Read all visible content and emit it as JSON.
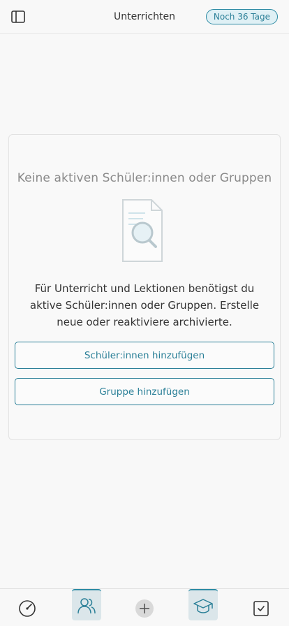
{
  "header": {
    "title": "Unterrichten",
    "trial_badge": "Noch 36 Tage",
    "sidebar_toggle_icon": "sidebar-panel-icon"
  },
  "empty_state": {
    "title": "Keine aktiven Schüler:innen oder Gruppen",
    "illustration": "document-search-icon",
    "description": "Für Unterricht und Lektionen benötigst du aktive Schüler:innen oder Gruppen. Erstelle neue oder reaktiviere archivierte.",
    "add_students_label": "Schüler:innen hinzufügen",
    "add_group_label": "Gruppe hinzufügen"
  },
  "bottom_nav": {
    "items": [
      {
        "icon": "dashboard-gauge-icon",
        "active": false
      },
      {
        "icon": "people-icon",
        "active": true
      },
      {
        "icon": "plus-circle-icon",
        "active": false
      },
      {
        "icon": "graduation-cap-icon",
        "active": true
      },
      {
        "icon": "checkbox-icon",
        "active": false
      }
    ]
  },
  "colors": {
    "accent": "#2a7f97",
    "badge_bg": "#dff0f5",
    "active_tab_bg": "#dbe6ea"
  }
}
